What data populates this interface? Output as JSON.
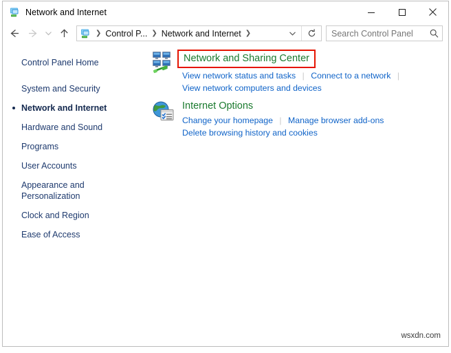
{
  "window": {
    "title": "Network and Internet",
    "title_icon": "network-folder-icon",
    "controls": {
      "minimize": "minimize-button",
      "maximize": "maximize-button",
      "close": "close-button"
    }
  },
  "navbar": {
    "back": "back-arrow-icon",
    "forward": "forward-arrow-icon",
    "recent": "recent-locations-chevron-icon",
    "up": "up-arrow-icon",
    "address_icon": "network-folder-icon",
    "breadcrumbs": [
      {
        "label": "Control P...",
        "truncated": true
      },
      {
        "label": "Network and Internet",
        "truncated": false
      }
    ],
    "dropdown": "chevron-down-icon",
    "refresh": "refresh-icon"
  },
  "search": {
    "placeholder": "Search Control Panel",
    "value": "",
    "icon": "search-icon"
  },
  "sidebar": {
    "items": [
      {
        "label": "Control Panel Home",
        "current": false,
        "header": true
      },
      {
        "label": "System and Security",
        "current": false,
        "header": false
      },
      {
        "label": "Network and Internet",
        "current": true,
        "header": false
      },
      {
        "label": "Hardware and Sound",
        "current": false,
        "header": false
      },
      {
        "label": "Programs",
        "current": false,
        "header": false
      },
      {
        "label": "User Accounts",
        "current": false,
        "header": false
      },
      {
        "label": "Appearance and Personalization",
        "current": false,
        "header": false
      },
      {
        "label": "Clock and Region",
        "current": false,
        "header": false
      },
      {
        "label": "Ease of Access",
        "current": false,
        "header": false
      }
    ]
  },
  "content": {
    "categories": [
      {
        "title": "Network and Sharing Center",
        "icon": "network-computers-icon",
        "highlighted": true,
        "highlight_color": "#e51400",
        "link_rows": [
          [
            "View network status and tasks",
            "Connect to a network",
            ""
          ],
          [
            "View network computers and devices"
          ]
        ]
      },
      {
        "title": "Internet Options",
        "icon": "internet-options-globe-icon",
        "highlighted": false,
        "link_rows": [
          [
            "Change your homepage",
            "Manage browser add-ons"
          ],
          [
            "Delete browsing history and cookies"
          ]
        ]
      }
    ]
  },
  "watermark": {
    "text": "wsxdn.com"
  },
  "colors": {
    "heading_green": "#1a7a2e",
    "link_blue": "#0f63c8",
    "sidebar_blue": "#1e3a6e",
    "highlight_red": "#e51400"
  }
}
